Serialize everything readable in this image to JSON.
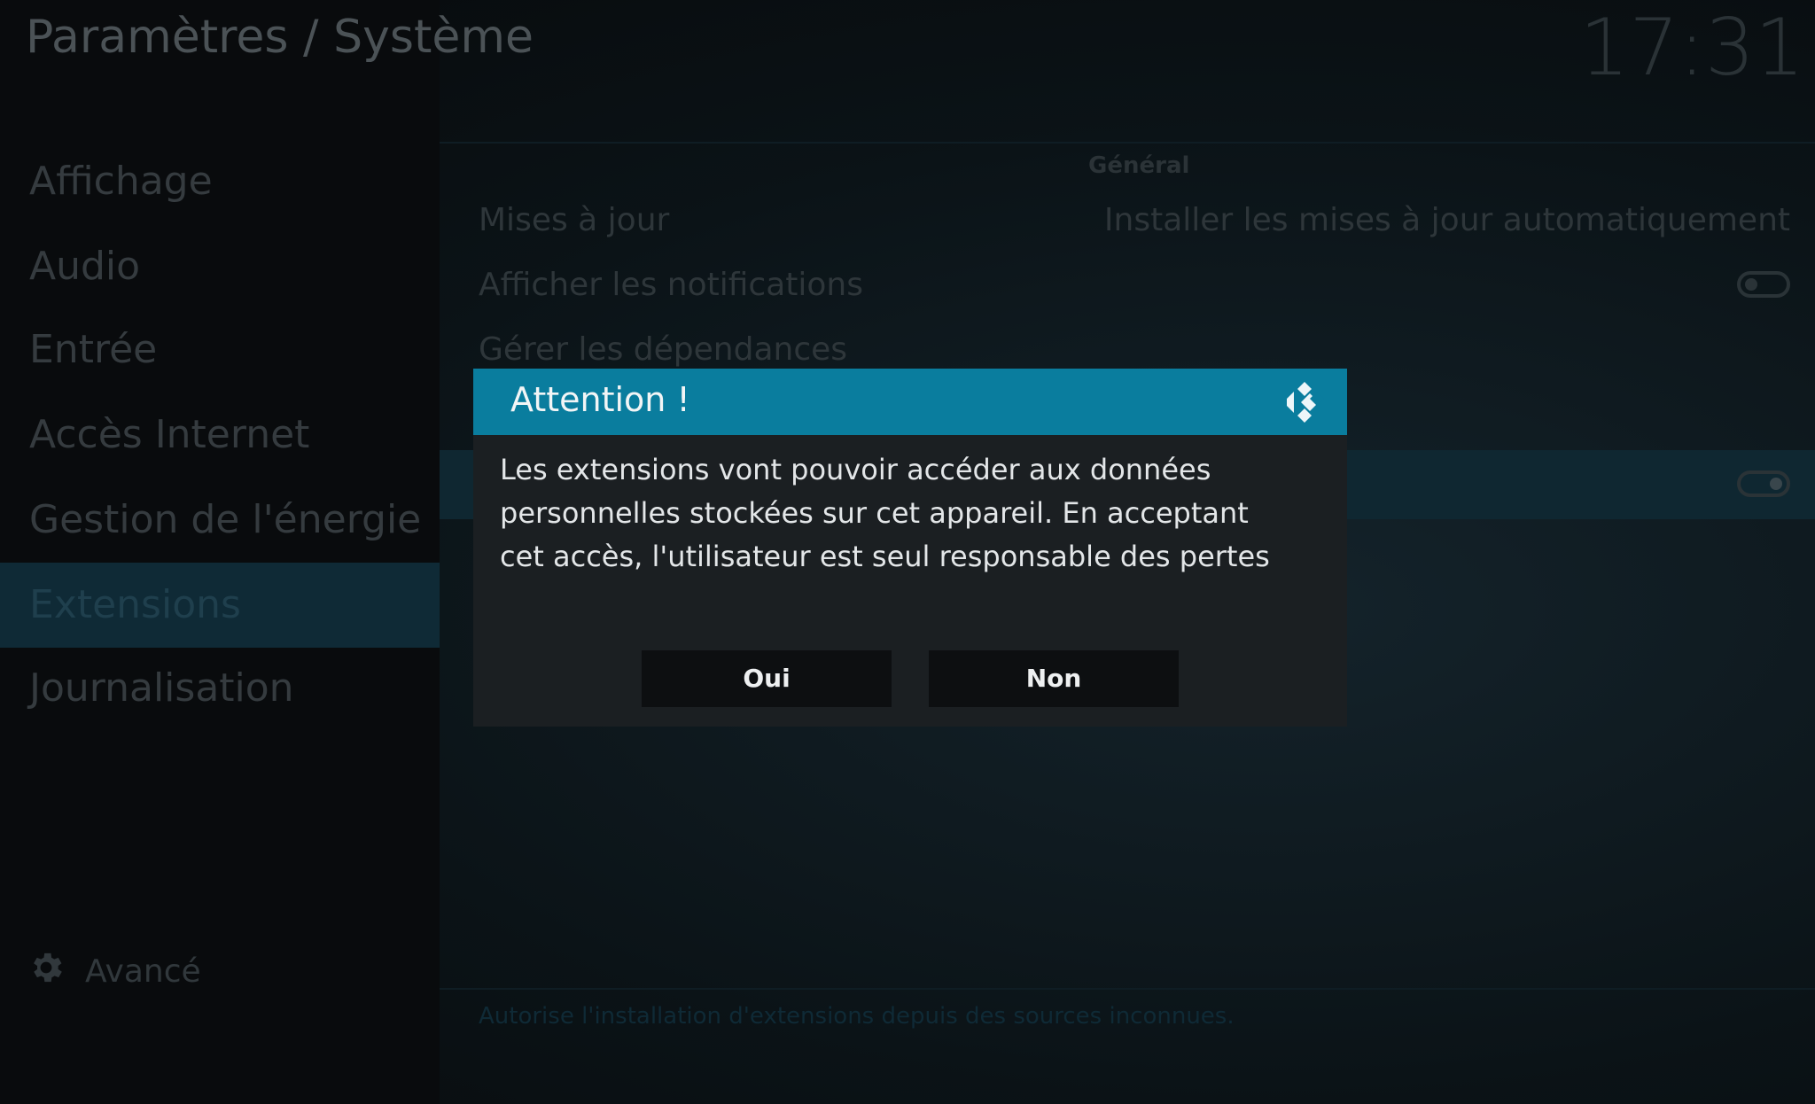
{
  "header": {
    "title": "Paramètres / Système",
    "clock": "17:31"
  },
  "sidebar": {
    "items": [
      {
        "label": "Affichage"
      },
      {
        "label": "Audio"
      },
      {
        "label": "Entrée"
      },
      {
        "label": "Accès Internet"
      },
      {
        "label": "Gestion de l'énergie"
      },
      {
        "label": "Extensions",
        "active": true
      },
      {
        "label": "Journalisation"
      }
    ],
    "advanced_label": "Avancé",
    "advanced_icon": "gear-icon"
  },
  "panel": {
    "group_heading": "Général",
    "settings": [
      {
        "label": "Mises à jour",
        "value": "Installer les mises à jour automatiquement"
      },
      {
        "label": "Afficher les notifications",
        "toggle": "off"
      },
      {
        "label": "Gérer les dépendances"
      }
    ],
    "highlighted_toggle": "on",
    "footer_help": "Autorise l'installation d'extensions depuis des sources inconnues."
  },
  "dialog": {
    "title": "Attention !",
    "logo_icon": "kodi-logo-icon",
    "message": "Les extensions vont pouvoir  accéder aux données personnelles stockées sur cet appareil. En acceptant cet accès, l'utilisateur est seul responsable des pertes de données, comportements non souhaités et dommages à",
    "yes_label": "Oui",
    "no_label": "Non"
  },
  "colors": {
    "accent": "#0a7d9e",
    "dialog_bg": "#1b1f22",
    "active_item_bg": "#0f2a36"
  }
}
